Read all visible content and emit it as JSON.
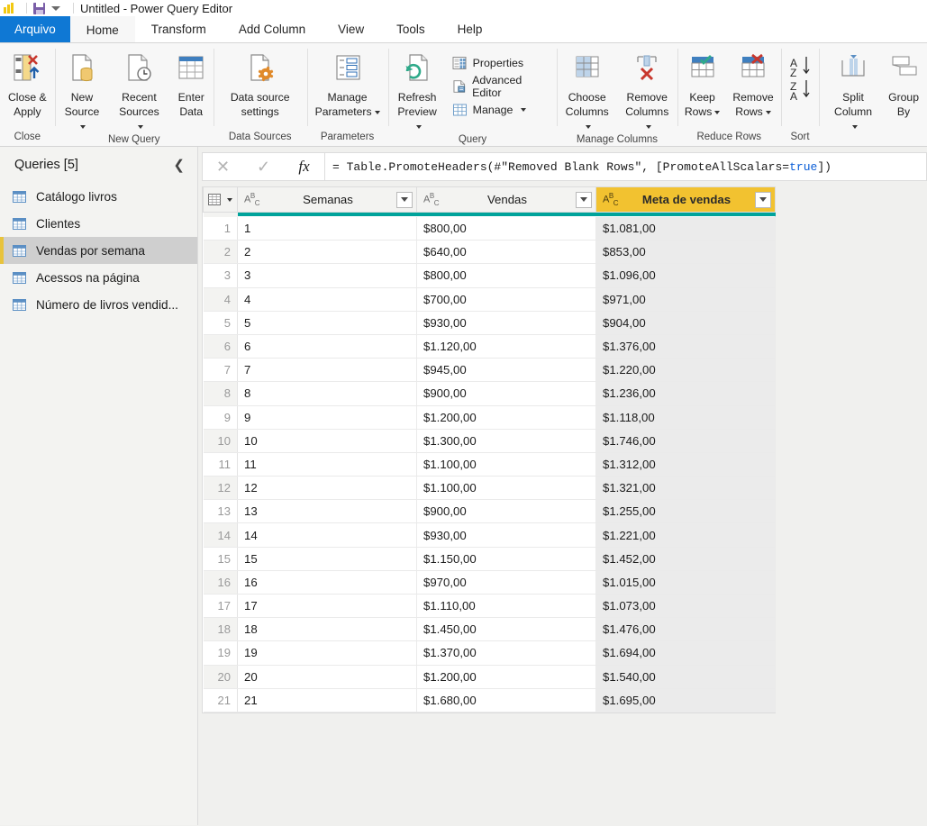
{
  "titlebar": {
    "doc_title": "Untitled - Power Query Editor",
    "logo_name": "power-bi-logo",
    "save_label": "save-icon",
    "dropdown_label": "customize-quick-access-icon"
  },
  "tabs": [
    {
      "label": "Arquivo",
      "kind": "file"
    },
    {
      "label": "Home",
      "kind": "active"
    },
    {
      "label": "Transform",
      "kind": "normal"
    },
    {
      "label": "Add Column",
      "kind": "normal"
    },
    {
      "label": "View",
      "kind": "normal"
    },
    {
      "label": "Tools",
      "kind": "normal"
    },
    {
      "label": "Help",
      "kind": "normal"
    }
  ],
  "ribbon": {
    "groups": [
      {
        "name": "Close",
        "label": "Close",
        "buttons": [
          {
            "label": "Close &\nApply",
            "icon": "close-and-apply-icon",
            "caret": true
          }
        ]
      },
      {
        "name": "New Query",
        "label": "New Query",
        "buttons": [
          {
            "label": "New\nSource",
            "icon": "new-source-icon",
            "caret": true
          },
          {
            "label": "Recent\nSources",
            "icon": "recent-sources-icon",
            "caret": true
          },
          {
            "label": "Enter\nData",
            "icon": "enter-data-icon",
            "caret": false
          }
        ]
      },
      {
        "name": "Data Sources",
        "label": "Data Sources",
        "buttons": [
          {
            "label": "Data source\nsettings",
            "icon": "data-source-settings-icon",
            "caret": false
          }
        ]
      },
      {
        "name": "Parameters",
        "label": "Parameters",
        "buttons": [
          {
            "label": "Manage\nParameters",
            "icon": "manage-parameters-icon",
            "caret": true
          }
        ]
      },
      {
        "name": "Query",
        "label": "Query",
        "buttons": [
          {
            "label": "Refresh\nPreview",
            "icon": "refresh-preview-icon",
            "caret": true
          }
        ],
        "small_buttons": [
          {
            "label": "Properties",
            "icon": "properties-icon",
            "caret": false
          },
          {
            "label": "Advanced Editor",
            "icon": "advanced-editor-icon",
            "caret": false
          },
          {
            "label": "Manage",
            "icon": "manage-icon",
            "caret": true
          }
        ]
      },
      {
        "name": "Manage Columns",
        "label": "Manage Columns",
        "buttons": [
          {
            "label": "Choose\nColumns",
            "icon": "choose-columns-icon",
            "caret": true
          },
          {
            "label": "Remove\nColumns",
            "icon": "remove-columns-icon",
            "caret": true
          }
        ]
      },
      {
        "name": "Reduce Rows",
        "label": "Reduce Rows",
        "buttons": [
          {
            "label": "Keep\nRows",
            "icon": "keep-rows-icon",
            "caret": true
          },
          {
            "label": "Remove\nRows",
            "icon": "remove-rows-icon",
            "caret": true
          }
        ]
      },
      {
        "name": "Sort",
        "label": "Sort",
        "buttons": [
          {
            "label": "",
            "icon": "sort-ascending-descending-icon",
            "caret": false
          }
        ]
      },
      {
        "name": "Transform",
        "label": "",
        "buttons": [
          {
            "label": "Split\nColumn",
            "icon": "split-column-icon",
            "caret": true
          },
          {
            "label": "Group\nBy",
            "icon": "group-by-icon",
            "caret": false
          }
        ]
      }
    ]
  },
  "sidebar": {
    "title": "Queries [5]",
    "collapse_icon": "chevron-left-icon",
    "items": [
      {
        "label": "Catálogo livros",
        "selected": false
      },
      {
        "label": "Clientes",
        "selected": false
      },
      {
        "label": "Vendas por semana",
        "selected": true
      },
      {
        "label": "Acessos na página",
        "selected": false
      },
      {
        "label": "Número de livros vendid...",
        "selected": false
      }
    ]
  },
  "formula_bar": {
    "cancel_icon": "cancel-icon",
    "accept_icon": "accept-checkmark-icon",
    "fx_icon": "fx-icon",
    "prefix": "= Table.PromoteHeaders(#\"Removed Blank Rows\", [PromoteAllScalars=",
    "keyword": "true",
    "suffix": "])",
    "full_value": "= Table.PromoteHeaders(#\"Removed Blank Rows\", [PromoteAllScalars=true])"
  },
  "grid": {
    "select_all_icon": "select-all-table-icon",
    "type_glyph": "ABC",
    "columns": [
      {
        "name": "Semanas",
        "type": "ABC",
        "highlighted": false,
        "quality": "#00a39b"
      },
      {
        "name": "Vendas",
        "type": "ABC",
        "highlighted": false,
        "quality": "#00a39b"
      },
      {
        "name": "Meta de vendas",
        "type": "ABC",
        "highlighted": true,
        "quality": "#00a39b"
      }
    ],
    "rows": [
      {
        "n": "1",
        "semanas": "1",
        "vendas": "$800,00",
        "meta": "$1.081,00"
      },
      {
        "n": "2",
        "semanas": "2",
        "vendas": "$640,00",
        "meta": "$853,00"
      },
      {
        "n": "3",
        "semanas": "3",
        "vendas": "$800,00",
        "meta": "$1.096,00"
      },
      {
        "n": "4",
        "semanas": "4",
        "vendas": "$700,00",
        "meta": "$971,00"
      },
      {
        "n": "5",
        "semanas": "5",
        "vendas": "$930,00",
        "meta": "$904,00"
      },
      {
        "n": "6",
        "semanas": "6",
        "vendas": "$1.120,00",
        "meta": "$1.376,00"
      },
      {
        "n": "7",
        "semanas": "7",
        "vendas": "$945,00",
        "meta": "$1.220,00"
      },
      {
        "n": "8",
        "semanas": "8",
        "vendas": "$900,00",
        "meta": "$1.236,00"
      },
      {
        "n": "9",
        "semanas": "9",
        "vendas": "$1.200,00",
        "meta": "$1.118,00"
      },
      {
        "n": "10",
        "semanas": "10",
        "vendas": "$1.300,00",
        "meta": "$1.746,00"
      },
      {
        "n": "11",
        "semanas": "11",
        "vendas": "$1.100,00",
        "meta": "$1.312,00"
      },
      {
        "n": "12",
        "semanas": "12",
        "vendas": "$1.100,00",
        "meta": "$1.321,00"
      },
      {
        "n": "13",
        "semanas": "13",
        "vendas": "$900,00",
        "meta": "$1.255,00"
      },
      {
        "n": "14",
        "semanas": "14",
        "vendas": "$930,00",
        "meta": "$1.221,00"
      },
      {
        "n": "15",
        "semanas": "15",
        "vendas": "$1.150,00",
        "meta": "$1.452,00"
      },
      {
        "n": "16",
        "semanas": "16",
        "vendas": "$970,00",
        "meta": "$1.015,00"
      },
      {
        "n": "17",
        "semanas": "17",
        "vendas": "$1.110,00",
        "meta": "$1.073,00"
      },
      {
        "n": "18",
        "semanas": "18",
        "vendas": "$1.450,00",
        "meta": "$1.476,00"
      },
      {
        "n": "19",
        "semanas": "19",
        "vendas": "$1.370,00",
        "meta": "$1.694,00"
      },
      {
        "n": "20",
        "semanas": "20",
        "vendas": "$1.200,00",
        "meta": "$1.540,00"
      },
      {
        "n": "21",
        "semanas": "21",
        "vendas": "$1.680,00",
        "meta": "$1.695,00"
      }
    ]
  },
  "colors": {
    "file_tab": "#0f78d4",
    "gold_header": "#f2c230",
    "quality_bar": "#00a39b",
    "selection_accent": "#e8c33c"
  }
}
